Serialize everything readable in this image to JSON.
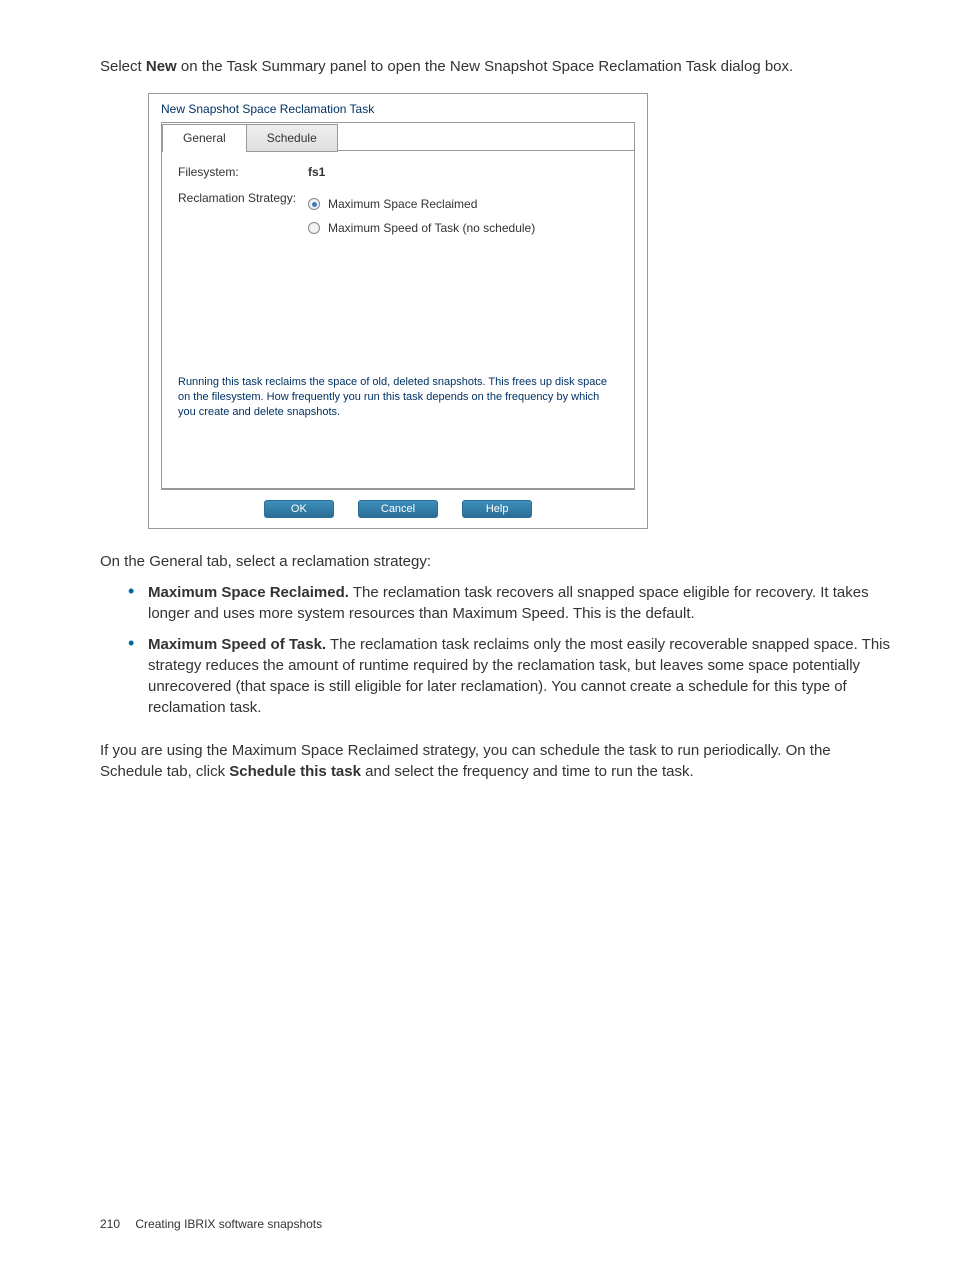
{
  "intro": {
    "prefix": "Select ",
    "bold": "New",
    "suffix": " on the Task Summary panel to open the New Snapshot Space Reclamation Task dialog box."
  },
  "dialog": {
    "title": "New Snapshot Space Reclamation Task",
    "tabs": {
      "general": "General",
      "schedule": "Schedule"
    },
    "filesystem_label": "Filesystem:",
    "filesystem_value": "fs1",
    "strategy_label": "Reclamation Strategy:",
    "radio1": "Maximum Space Reclaimed",
    "radio2": "Maximum Speed of Task (no schedule)",
    "info": "Running this task reclaims the space of old, deleted snapshots. This frees up disk space on the filesystem. How frequently you run this task depends on the frequency by which you create and delete snapshots.",
    "buttons": {
      "ok": "OK",
      "cancel": "Cancel",
      "help": "Help"
    }
  },
  "post": {
    "lead": "On the General tab, select a reclamation strategy:",
    "bullet1_bold": "Maximum Space Reclaimed.",
    "bullet1_text": " The reclamation task recovers all snapped space eligible for recovery. It takes longer and uses more system resources than Maximum Speed. This is the default.",
    "bullet2_bold": "Maximum Speed of Task.",
    "bullet2_text": " The reclamation task reclaims only the most easily recoverable snapped space. This strategy reduces the amount of runtime required by the reclamation task, but leaves some space potentially unrecovered (that space is still eligible for later reclamation). You cannot create a schedule for this type of reclamation task.",
    "trail_prefix": "If you are using the Maximum Space Reclaimed strategy, you can schedule the task to run periodically. On the Schedule tab, click ",
    "trail_bold": "Schedule this task",
    "trail_suffix": " and select the frequency and time to run the task."
  },
  "footer": {
    "page": "210",
    "chapter": "Creating IBRIX software snapshots"
  }
}
